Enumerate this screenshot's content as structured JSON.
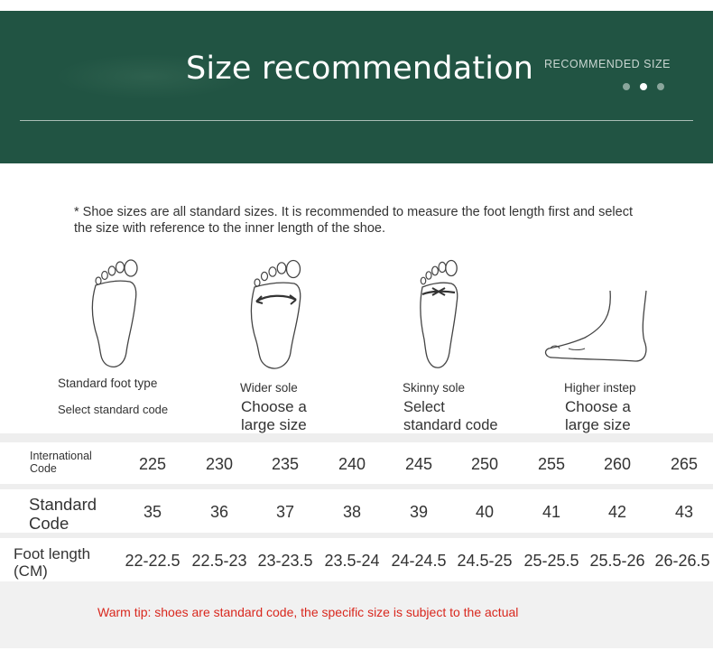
{
  "banner": {
    "title": "Size recommendation",
    "subtitle": "RECOMMENDED SIZE",
    "pager_dots": 3,
    "active_dot": 2,
    "background_color": "#215443"
  },
  "note": "* Shoe sizes are all standard sizes. It is recommended to measure the foot length first and select the size with reference to the inner length of the shoe.",
  "foot_types": [
    {
      "name": "Standard foot type",
      "advice": "Select standard code",
      "icon": "standard-foot-icon"
    },
    {
      "name": "Wider sole",
      "advice": "Choose a large size",
      "icon": "wide-foot-icon"
    },
    {
      "name": "Skinny sole",
      "advice": "Select standard code",
      "icon": "skinny-foot-icon"
    },
    {
      "name": "Higher instep",
      "advice": "Choose a large size",
      "icon": "high-instep-foot-icon"
    }
  ],
  "size_table": {
    "rows": [
      {
        "label": "International Code",
        "values": [
          "225",
          "230",
          "235",
          "240",
          "245",
          "250",
          "255",
          "260",
          "265"
        ]
      },
      {
        "label": "Standard Code",
        "values": [
          "35",
          "36",
          "37",
          "38",
          "39",
          "40",
          "41",
          "42",
          "43"
        ]
      },
      {
        "label": "Foot length (CM)",
        "values": [
          "22-22.5",
          "22.5-23",
          "23-23.5",
          "23.5-24",
          "24-24.5",
          "24.5-25",
          "25-25.5",
          "25.5-26",
          "26-26.5"
        ]
      }
    ]
  },
  "tip": {
    "text": "Warm tip: shoes are standard code, the specific size is subject to the actual",
    "color": "#d9281e"
  }
}
